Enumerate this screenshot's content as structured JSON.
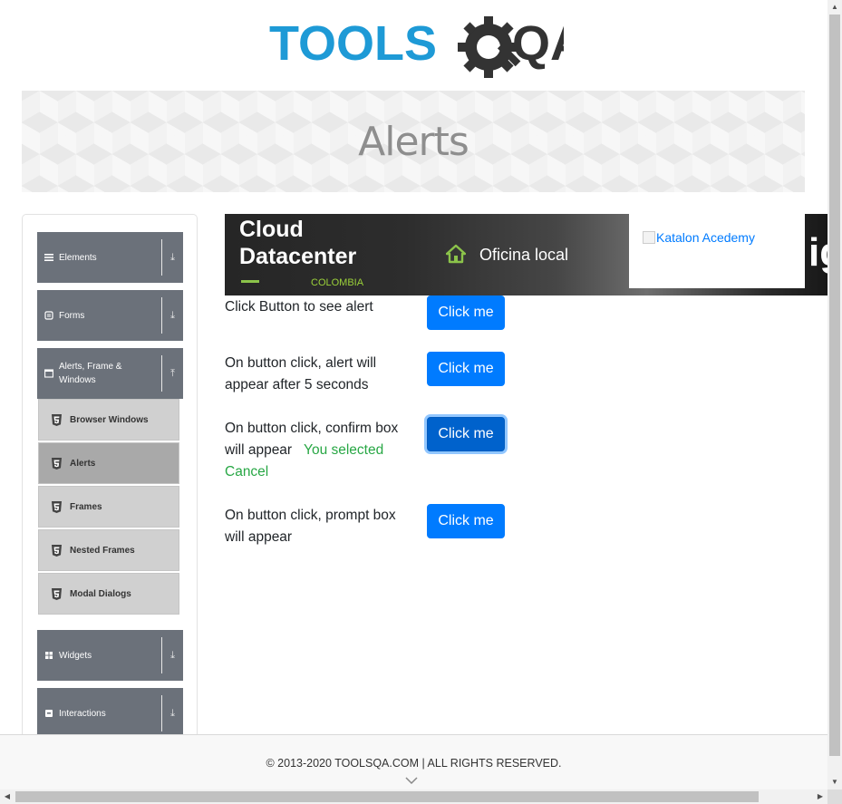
{
  "header": {
    "logo_text_left": "TOOLS",
    "logo_text_right": "QA",
    "colors": {
      "logo_blue": "#1e9ad6",
      "logo_dark": "#333333"
    }
  },
  "banner": {
    "title": "Alerts"
  },
  "sidebar": {
    "groups": [
      {
        "label": "Elements",
        "icon": "hamburger-icon",
        "arrow": "download-arrow-icon"
      },
      {
        "label": "Forms",
        "icon": "list-icon",
        "arrow": "download-arrow-icon"
      },
      {
        "label": "Alerts, Frame & Windows",
        "icon": "window-icon",
        "arrow": "upload-arrow-icon"
      },
      {
        "label": "Widgets",
        "icon": "grid-icon",
        "arrow": "download-arrow-icon"
      },
      {
        "label": "Interactions",
        "icon": "square-icon",
        "arrow": "download-arrow-icon"
      }
    ],
    "sub_items": [
      {
        "label": "Browser Windows",
        "icon": "html5-icon"
      },
      {
        "label": "Alerts",
        "icon": "html5-icon",
        "active": true
      },
      {
        "label": "Frames",
        "icon": "html5-icon"
      },
      {
        "label": "Nested Frames",
        "icon": "html5-icon"
      },
      {
        "label": "Modal Dialogs",
        "icon": "html5-icon"
      }
    ]
  },
  "ad": {
    "title_line1": "Cloud",
    "title_line2": "Datacenter",
    "country": "COLOMBIA",
    "office": "Oficina local",
    "trailing": "ig",
    "katalon_alt": "Katalon Acedemy"
  },
  "rows": [
    {
      "text": "Click Button to see alert",
      "button": "Click me"
    },
    {
      "text": "On button click, alert will appear after 5 seconds",
      "button": "Click me"
    },
    {
      "text": "On button click, confirm box will appear",
      "result": "You selected Cancel",
      "button": "Click me"
    },
    {
      "text": "On button click, prompt box will appear",
      "button": "Click me"
    }
  ],
  "footer": {
    "copyright": "© 2013-2020 TOOLSQA.COM | ALL RIGHTS RESERVED."
  },
  "colors": {
    "primary": "#007bff",
    "success": "#28a745",
    "sidebar_header": "#6b717a"
  }
}
